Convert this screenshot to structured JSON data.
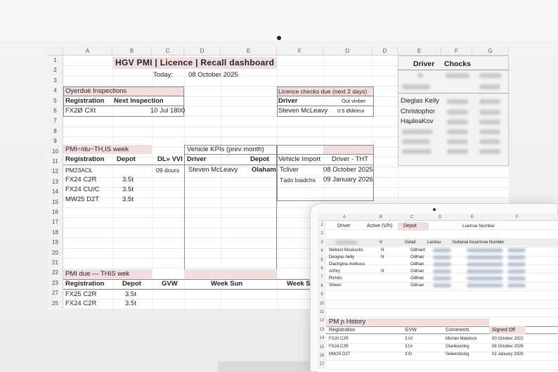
{
  "columns_left": [
    "A",
    "B",
    "C",
    "D",
    "E",
    "F",
    "D",
    "D",
    "E",
    "F",
    "G"
  ],
  "row_numbers": [
    "1",
    "2",
    "3",
    "4",
    "5",
    "6",
    "7",
    "8",
    "9",
    "10",
    "11",
    "12",
    "13",
    "14",
    "15",
    "16",
    "17",
    "18",
    "19",
    "20",
    "21",
    "22",
    "23",
    "27",
    "25"
  ],
  "title": "HGV PMI | Licence | Recall dashboard",
  "today_label": "Today:",
  "today_value": "08 October 2025",
  "overdue": {
    "header": "Oyerduė Inspections",
    "col1": "Registration",
    "col2": "Next Inspection",
    "reg": "FX2Ø CXt",
    "date": "10 Jul 1800"
  },
  "licence": {
    "header": "Licence checks due (next 2 days)",
    "col1": "Driver",
    "col2": "Out vinber",
    "name": "Steven McLeavy",
    "value": "0:5 Ødkleur"
  },
  "right_panel": {
    "col1": "Driver",
    "col2": "Chocks",
    "names": [
      "Dieglas Kelly",
      "Christophor",
      "HaµleaKov"
    ]
  },
  "pmi_due": {
    "header": "PMI÷/du−TH,IS week",
    "col1": "Registration",
    "col2": "Depot",
    "col3": "DL» VVI",
    "rows": [
      {
        "reg": "PM23ACŁ",
        "depot": "",
        "extra": "09 dours"
      },
      {
        "reg": "FX24 C2R",
        "depot": "3.5t",
        "extra": ""
      },
      {
        "reg": "FX24 CU/C",
        "depot": "3.5t",
        "extra": ""
      },
      {
        "reg": "MW25 D2T",
        "depot": "3.5t",
        "extra": ""
      }
    ]
  },
  "kpi": {
    "header": "Vehicle KPIs (prev month)",
    "col1": "Driver",
    "col2": "Depot",
    "name": "Steven McLeavy",
    "depot": "Olaham"
  },
  "vehicle_import": {
    "col1": "Vehicle Import",
    "col2": "Driver - THT",
    "rows": [
      {
        "a": "Tcliver",
        "b": "08 October 2025"
      },
      {
        "a": "Tạdo loadchs",
        "b": "09 January 2026"
      }
    ]
  },
  "pmi_this": {
    "header": "PMI due — THIS wek",
    "col1": "Registration",
    "col2": "Depot",
    "col3": "GVW",
    "col4": "Week Sun",
    "col5": "Week Se",
    "rows": [
      {
        "reg": "FX25 C2R",
        "depot": "3.5t"
      },
      {
        "reg": "FX24 C2R",
        "depot": "3.5t"
      }
    ]
  },
  "tablet": {
    "columns": [
      "A",
      "B",
      "C",
      "D",
      "E",
      "F"
    ],
    "row_numbers": [
      "1",
      "2",
      "3",
      "4",
      "5",
      "6",
      "7",
      "8",
      "9",
      "10",
      "11",
      "12",
      "13",
      "14",
      "15",
      "16",
      "17"
    ],
    "h_driver": "Driver",
    "h_active": "Active (V/h)",
    "h_depot": "Depot",
    "h_licence": "Luense Number",
    "sub_v": "V",
    "sub_detail": "Detail",
    "sub_lieslou": "Lieslou",
    "sub_ni": "Nutional Insurnnoe Number",
    "drivers": [
      {
        "name": "Webest Muskocks",
        "v": "N",
        "depot": "Odlnant"
      },
      {
        "name": "Deoglas helly",
        "v": "N",
        "depot": "Odlhan"
      },
      {
        "name": "Dlachgtna molkocu",
        "v": "",
        "depot": "Odlhan"
      },
      {
        "name": "Arthry",
        "v": "N",
        "depot": "Odlnan"
      },
      {
        "name": "Richdo",
        "v": "",
        "depot": "Odlhan"
      },
      {
        "name": "Streen",
        "v": "",
        "depot": "Odlnan"
      }
    ],
    "history_title": "PM ɲ Hstory",
    "hist_cols": [
      "Registration",
      "GVW",
      "Comments",
      "Signed Off"
    ],
    "hist_rows": [
      {
        "reg": "FX20 C2R",
        "gvw": "3.Ut",
        "comment": "Michiel Matelock",
        "date": "00 October 2022"
      },
      {
        "reg": "FX24.C2R",
        "gvw": "3.Ur",
        "comment": "Otankuwring",
        "date": "08 October 2026"
      },
      {
        "reg": "MW25 D2T",
        "gvw": "3.5t",
        "comment": "Seleerdockg",
        "date": "02 January 2026"
      }
    ]
  }
}
